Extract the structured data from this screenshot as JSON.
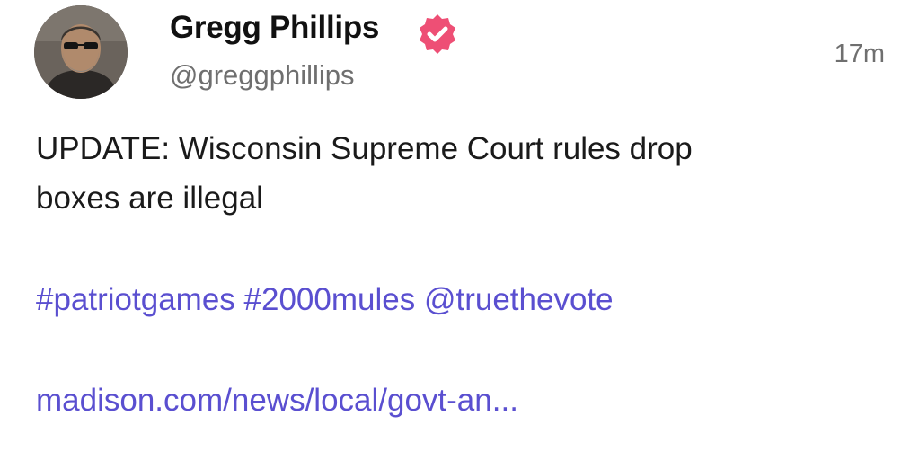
{
  "author": {
    "display_name": "Gregg Phillips",
    "handle": "@greggphillips",
    "verified_icon": "verified-badge-icon",
    "verified_color": "#ee4f75"
  },
  "post": {
    "timestamp": "17m",
    "text_line_1": "UPDATE: Wisconsin Supreme Court rules drop",
    "text_line_2": "boxes are illegal",
    "tags": [
      "#patriotgames",
      "#2000mules",
      "@truethevote"
    ],
    "link": "madison.com/news/local/govt-an..."
  },
  "colors": {
    "link": "#5a4fd0",
    "secondary_text": "#6f6f6f",
    "primary_text": "#1a1a1a"
  }
}
